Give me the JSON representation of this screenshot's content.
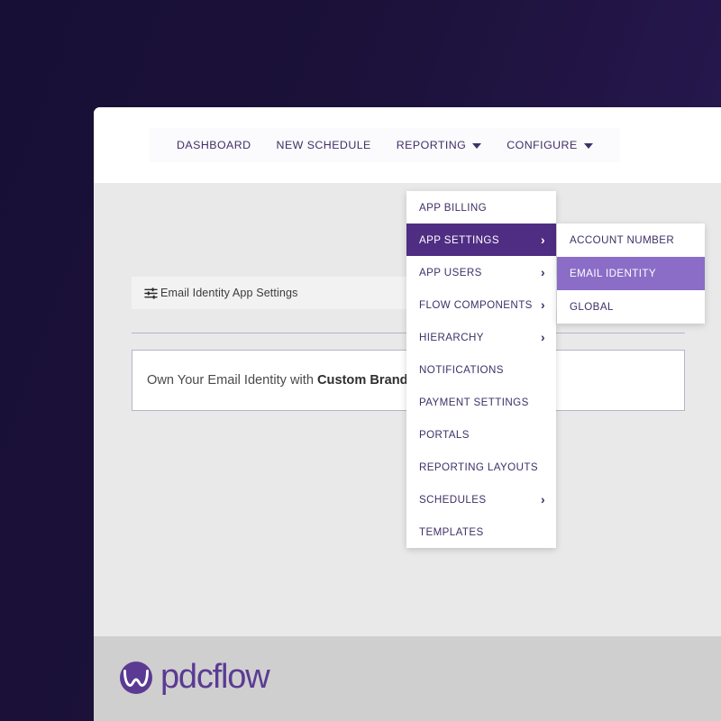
{
  "window": {
    "background_gradient_from": "#180f36",
    "background_gradient_to": "#2b1a55"
  },
  "topnav": {
    "items": [
      {
        "label": "DASHBOARD",
        "has_caret": false
      },
      {
        "label": "NEW SCHEDULE",
        "has_caret": false
      },
      {
        "label": "REPORTING",
        "has_caret": true
      },
      {
        "label": "CONFIGURE",
        "has_caret": true
      }
    ]
  },
  "page": {
    "title": "Email Identity App Settings",
    "title_icon": "sliders-icon",
    "promo_text_plain": "Own Your Email Identity with ",
    "promo_text_bold": "Custom Branding"
  },
  "dropdown": {
    "active_color": "#4f2d82",
    "text_color": "#3f3068",
    "items": [
      {
        "label": "APP BILLING",
        "has_submenu": false,
        "active": false
      },
      {
        "label": "APP SETTINGS",
        "has_submenu": true,
        "active": true
      },
      {
        "label": "APP USERS",
        "has_submenu": true,
        "active": false
      },
      {
        "label": "FLOW COMPONENTS",
        "has_submenu": true,
        "active": false
      },
      {
        "label": "HIERARCHY",
        "has_submenu": true,
        "active": false
      },
      {
        "label": "NOTIFICATIONS",
        "has_submenu": false,
        "active": false
      },
      {
        "label": "PAYMENT SETTINGS",
        "has_submenu": false,
        "active": false
      },
      {
        "label": "PORTALS",
        "has_submenu": false,
        "active": false
      },
      {
        "label": "REPORTING LAYOUTS",
        "has_submenu": false,
        "active": false
      },
      {
        "label": "SCHEDULES",
        "has_submenu": true,
        "active": false
      },
      {
        "label": "TEMPLATES",
        "has_submenu": false,
        "active": false
      }
    ],
    "chevron_glyph": "›"
  },
  "submenu": {
    "active_color": "#8b6dc7",
    "items": [
      {
        "label": "ACCOUNT NUMBER",
        "active": false
      },
      {
        "label": "EMAIL IDENTITY",
        "active": true
      },
      {
        "label": "GLOBAL",
        "active": false
      }
    ]
  },
  "footer": {
    "logo_word": "pdcflow",
    "logo_color": "#5b3a93",
    "logo_mark": "pdcflow-wave-logo-icon"
  }
}
